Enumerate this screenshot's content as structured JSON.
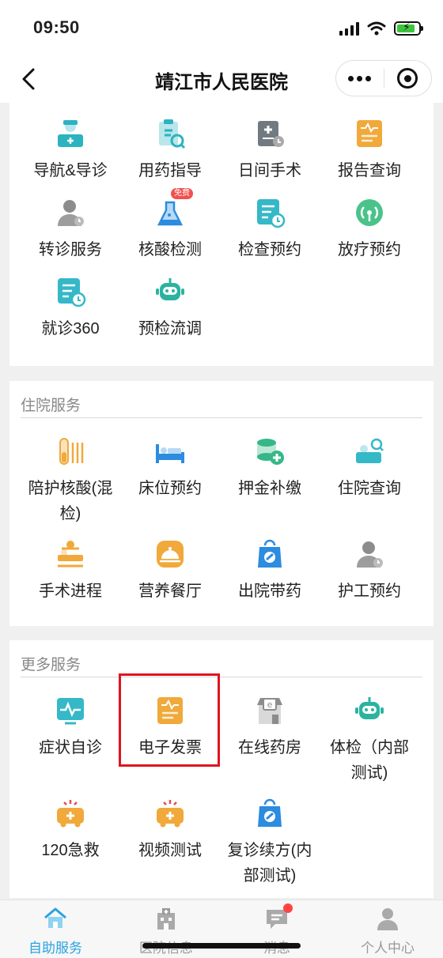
{
  "status": {
    "time": "09:50"
  },
  "nav": {
    "title": "靖江市人民医院"
  },
  "top_section": {
    "items": [
      {
        "label": "导航&导诊",
        "icon": "nurse-icon",
        "color": "#2bb3c0"
      },
      {
        "label": "用药指导",
        "icon": "medicine-clipboard-icon",
        "color": "#2bb3c0"
      },
      {
        "label": "日间手术",
        "icon": "surgery-clipboard-icon",
        "color": "#707a80"
      },
      {
        "label": "报告查询",
        "icon": "report-icon",
        "color": "#f0a93a"
      },
      {
        "label": "转诊服务",
        "icon": "doctor-avatar-icon",
        "color": "#8c8c8c"
      },
      {
        "label": "核酸检测",
        "icon": "flask-icon",
        "color": "#2b8ce0",
        "badge": "免费"
      },
      {
        "label": "检查预约",
        "icon": "calendar-doc-icon",
        "color": "#35b8c8"
      },
      {
        "label": "放疗预约",
        "icon": "radiation-icon",
        "color": "#4ac38a"
      },
      {
        "label": "就诊360",
        "icon": "clock-doc-icon",
        "color": "#35b8c8"
      },
      {
        "label": "预检流调",
        "icon": "robot-icon",
        "color": "#2bb3a0"
      }
    ]
  },
  "inpatient_section": {
    "title": "住院服务",
    "items": [
      {
        "label": "陪护核酸(混检)",
        "icon": "test-tube-icon",
        "color": "#f0a93a"
      },
      {
        "label": "床位预约",
        "icon": "bed-icon",
        "color": "#2b8ce0"
      },
      {
        "label": "押金补缴",
        "icon": "coins-icon",
        "color": "#35b888"
      },
      {
        "label": "住院查询",
        "icon": "patient-search-icon",
        "color": "#35b8c8"
      },
      {
        "label": "手术进程",
        "icon": "operation-icon",
        "color": "#f0a93a"
      },
      {
        "label": "营养餐厅",
        "icon": "dish-icon",
        "color": "#f0a93a"
      },
      {
        "label": "出院带药",
        "icon": "medicine-bag-icon",
        "color": "#2b8ce0"
      },
      {
        "label": "护工预约",
        "icon": "caregiver-icon",
        "color": "#8c8c8c"
      }
    ]
  },
  "more_section": {
    "title": "更多服务",
    "items": [
      {
        "label": "症状自诊",
        "icon": "heartbeat-monitor-icon",
        "color": "#35b8c8"
      },
      {
        "label": "电子发票",
        "icon": "invoice-icon",
        "color": "#f0a93a"
      },
      {
        "label": "在线药房",
        "icon": "pharmacy-icon",
        "color": "#8c8c8c"
      },
      {
        "label": "体检（内部测试)",
        "icon": "robot-icon",
        "color": "#2bb3a0"
      },
      {
        "label": "120急救",
        "icon": "ambulance-icon",
        "color": "#f0a93a"
      },
      {
        "label": "视频测试",
        "icon": "ambulance-icon",
        "color": "#f0a93a"
      },
      {
        "label": "复诊续方(内部测试)",
        "icon": "medicine-bag-icon",
        "color": "#2b8ce0"
      }
    ]
  },
  "tabbar": {
    "tabs": [
      {
        "label": "自助服务",
        "icon": "home-icon",
        "active": true
      },
      {
        "label": "医院信息",
        "icon": "hospital-icon",
        "active": false
      },
      {
        "label": "消息",
        "icon": "message-icon",
        "active": false,
        "dot": true
      },
      {
        "label": "个人中心",
        "icon": "person-icon",
        "active": false
      }
    ]
  }
}
